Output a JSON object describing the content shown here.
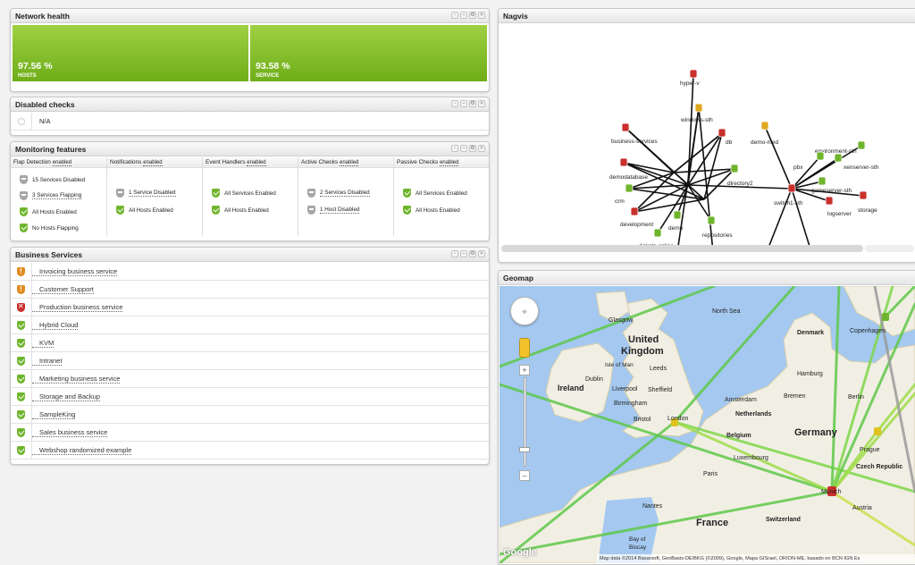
{
  "network_health": {
    "title": "Network health",
    "hosts": {
      "percent": "97.56 %",
      "label": "HOSTS"
    },
    "service": {
      "percent": "93.58 %",
      "label": "SERVICE"
    }
  },
  "disabled_checks": {
    "title": "Disabled checks",
    "value": "N/A"
  },
  "monitoring_features": {
    "title": "Monitoring features",
    "enabled_label": "enabled",
    "columns": [
      {
        "name": "Flap Detection",
        "rows": [
          "15 Services Disabled",
          "3 Services Flapping",
          "All Hosts Enabled",
          "No Hosts Flapping"
        ]
      },
      {
        "name": "Notifications",
        "rows": [
          "1 Service Disabled",
          "All Hosts Enabled"
        ]
      },
      {
        "name": "Event Handlers",
        "rows": [
          "All Services Enabled",
          "All Hosts Enabled"
        ]
      },
      {
        "name": "Active Checks",
        "rows": [
          "2 Services Disabled",
          "1 Host Disabled"
        ]
      },
      {
        "name": "Passive Checks",
        "rows": [
          "All Services Enabled",
          "All Hosts Enabled"
        ]
      }
    ]
  },
  "business_services": {
    "title": "Business Services",
    "items": [
      {
        "name": "Invoicing business service",
        "status": "warn"
      },
      {
        "name": "Customer Support",
        "status": "warn"
      },
      {
        "name": "Production business service",
        "status": "crit"
      },
      {
        "name": "Hybrid Cloud",
        "status": "ok"
      },
      {
        "name": "KVM",
        "status": "ok"
      },
      {
        "name": "Intranet",
        "status": "ok"
      },
      {
        "name": "Marketing business service",
        "status": "ok"
      },
      {
        "name": "Storage and Backup",
        "status": "ok"
      },
      {
        "name": "SampleKing",
        "status": "ok"
      },
      {
        "name": "Sales business service",
        "status": "ok"
      },
      {
        "name": "Webshop randomized example",
        "status": "ok"
      }
    ]
  },
  "nagvis": {
    "title": "Nagvis",
    "nodes": [
      "hyper-v",
      "windows-sth",
      "business-services",
      "demo-med",
      "environment-sth",
      "xenserver-sth",
      "demodatabase",
      "db",
      "directory2",
      "pbx",
      "gameserver-sth",
      "storage",
      "crm",
      "switch1-sth",
      "logserver",
      "development",
      "demo",
      "repositories",
      "tickets-online"
    ]
  },
  "geomap": {
    "title": "Geomap",
    "places": {
      "glasgow": "Glasgow",
      "north_sea": "North Sea",
      "uk1": "United",
      "uk2": "Kingdom",
      "isle_of_man": "Isle of Man",
      "leeds": "Leeds",
      "dublin": "Dublin",
      "ireland": "Ireland",
      "liverpool": "Liverpool",
      "sheffield": "Sheffield",
      "birmingham": "Birmingham",
      "bristol": "Bristol",
      "london": "London",
      "denmark": "Denmark",
      "copenhagen": "Copenhagen",
      "hamburg": "Hamburg",
      "amsterdam": "Amsterdam",
      "bremen": "Bremen",
      "berlin": "Berlin",
      "netherlands": "Netherlands",
      "belgium": "Belgium",
      "germany": "Germany",
      "luxembourg": "Luxembourg",
      "prague": "Prague",
      "czech": "Czech Republic",
      "paris": "Paris",
      "france": "France",
      "nantes": "Nantes",
      "switzerland": "Switzerland",
      "munich": "Munich",
      "austria": "Austria",
      "bay1": "Bay of",
      "bay2": "Biscay"
    },
    "logo": "Google",
    "attribution": "Map data ©2014 Basarsoft, GeoBasis-DE/BKG (©2009), Google, Mapa GISrael, ORION-ME, basado en BCN IGN Es"
  }
}
